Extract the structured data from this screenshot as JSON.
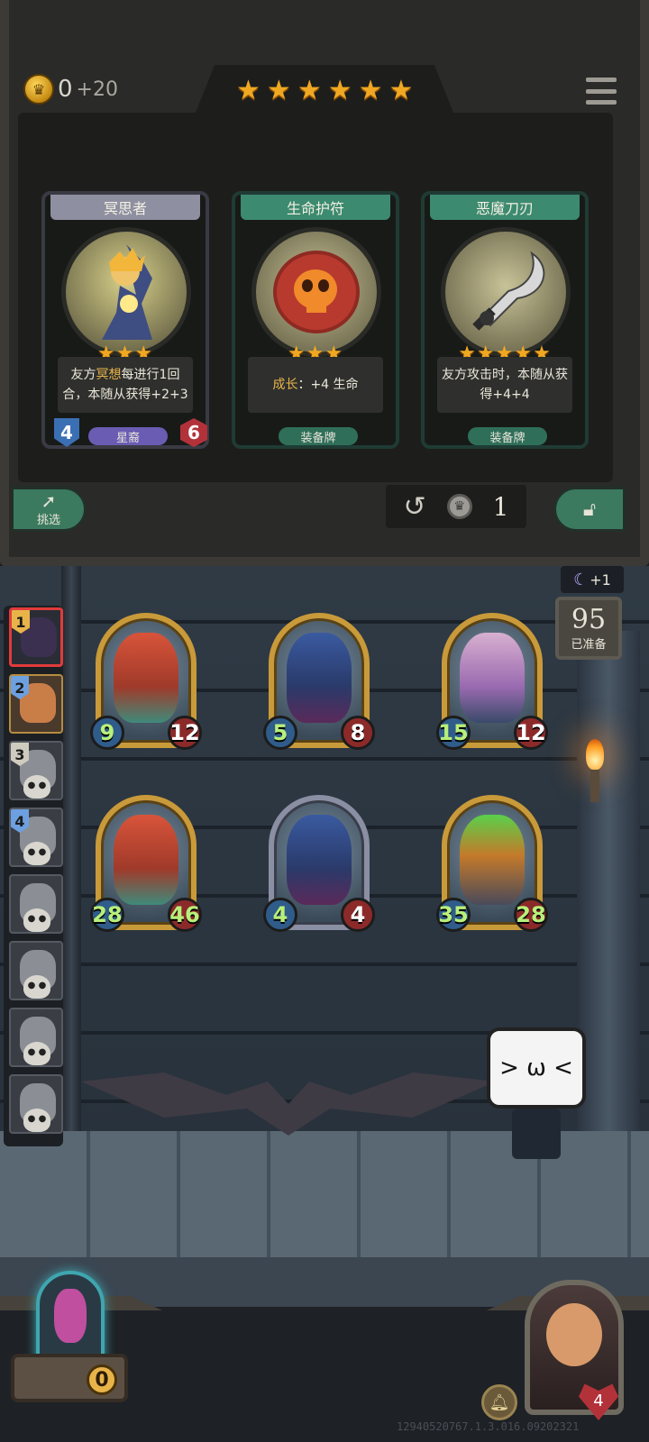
{
  "gold": {
    "current": "0",
    "income": "+20"
  },
  "tavern_stars": 6,
  "shop_cards": [
    {
      "name": "冥思者",
      "stars": "★★★",
      "desc_pre": "友方",
      "desc_hl": "冥想",
      "desc_post": "每进行1回合，本随从获得+2+3",
      "tag": "星裔",
      "attack": "4",
      "health": "6"
    },
    {
      "name": "生命护符",
      "stars": "★★★",
      "desc_hl": "成长",
      "desc_post": "：+4 生命",
      "tag": "装备牌"
    },
    {
      "name": "恶魔刀刃",
      "stars": "★★★★★",
      "desc_post": "友方攻击时，本随从获得+4+4",
      "tag": "装备牌"
    }
  ],
  "buttons": {
    "pick": "挑选",
    "refresh_cost": "1"
  },
  "ranking": [
    {
      "rank": "1"
    },
    {
      "rank": "2"
    },
    {
      "rank": "3"
    },
    {
      "rank": "4"
    },
    {
      "rank": ""
    },
    {
      "rank": ""
    },
    {
      "rank": ""
    },
    {
      "rank": ""
    }
  ],
  "mana_bonus": "+1",
  "ready": {
    "count": "95",
    "label": "已准备"
  },
  "shop_minions": [
    {
      "attack": "9",
      "health": "12"
    },
    {
      "attack": "5",
      "health": "8"
    },
    {
      "attack": "15",
      "health": "12"
    }
  ],
  "board_minions": [
    {
      "attack": "28",
      "health": "46"
    },
    {
      "attack": "4",
      "health": "4"
    },
    {
      "attack": "35",
      "health": "28"
    }
  ],
  "hero": {
    "health": "4"
  },
  "chest": {
    "count": "0"
  },
  "build_id": "12940520767.1.3.016.09202321",
  "colors": {
    "gold": "#f0a822",
    "green_frame": "#3c8a6f",
    "red_selected": "#e23b3b"
  }
}
